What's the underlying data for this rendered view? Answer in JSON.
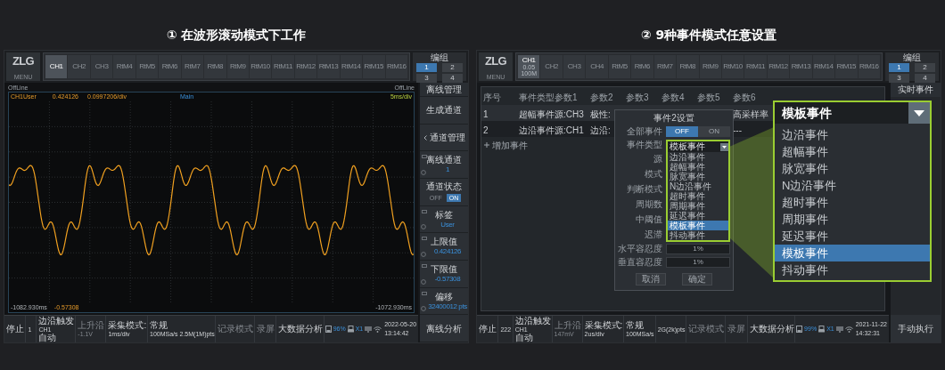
{
  "panels": [
    {
      "kind": "waveform",
      "title": "① 在波形滚动模式下工作",
      "topbar": {
        "logo": "ZLG",
        "menu": "MENU",
        "channels": [
          {
            "label": "CH1",
            "selected": true
          },
          {
            "label": "CH2",
            "selected": false
          },
          {
            "label": "CH3",
            "selected": false
          },
          {
            "label": "RtM4",
            "selected": false
          },
          {
            "label": "RtM5",
            "selected": false
          },
          {
            "label": "RtM6",
            "selected": false
          },
          {
            "label": "RtM7",
            "selected": false
          },
          {
            "label": "RtM8",
            "selected": false
          },
          {
            "label": "RtM9",
            "selected": false
          },
          {
            "label": "RtM10",
            "selected": false
          },
          {
            "label": "RtM11",
            "selected": false
          },
          {
            "label": "RtM12",
            "selected": false
          },
          {
            "label": "RtM13",
            "selected": false
          },
          {
            "label": "RtM14",
            "selected": false
          },
          {
            "label": "RtM15",
            "selected": false
          },
          {
            "label": "RtM16",
            "selected": false
          }
        ],
        "group": {
          "label": "编组",
          "buttons": [
            {
              "label": "1",
              "selected": true
            },
            {
              "label": "2",
              "selected": false
            },
            {
              "label": "3",
              "selected": false
            },
            {
              "label": "4",
              "selected": false
            }
          ]
        }
      },
      "scope": {
        "offline_left": "OffLine",
        "offline_right": "OffLine",
        "channel": "CH1User",
        "value": "0.424126",
        "scale": "0.0997206/div",
        "marker": "Main",
        "timebase": "5ms/div",
        "x_start": "-1082.930ms",
        "y_min": "-0.57308",
        "x_end": "-1072.930ms"
      },
      "sidebar": {
        "header": "离线管理",
        "items": [
          {
            "kind": "button",
            "label": "生成通道"
          },
          {
            "kind": "submenu",
            "label": "通道管理"
          },
          {
            "kind": "value",
            "label": "离线通道",
            "value": "1"
          },
          {
            "kind": "toggle",
            "label": "通道状态",
            "options": [
              {
                "label": "OFF",
                "selected": false
              },
              {
                "label": "ON",
                "selected": true
              }
            ]
          },
          {
            "kind": "value",
            "label": "标签",
            "value": "User"
          },
          {
            "kind": "value",
            "label": "上限值",
            "value": "0.424126"
          },
          {
            "kind": "value",
            "label": "下限值",
            "value": "-0.57308"
          },
          {
            "kind": "value",
            "label": "偏移",
            "value": "32400012 pts"
          },
          {
            "kind": "button",
            "label": "离线分析"
          }
        ]
      },
      "status_bar": {
        "cells": [
          {
            "lines": [
              {
                "kind": "label",
                "text": "停止"
              }
            ],
            "dim": false
          },
          {
            "lines": [
              {
                "kind": "value",
                "text": "1"
              }
            ],
            "dim": false
          },
          {
            "lines": [
              {
                "kind": "label",
                "text": "边沿触发"
              },
              {
                "kind": "value",
                "text": "CH1"
              },
              {
                "kind": "label",
                "text": "自动"
              }
            ],
            "dim": false
          },
          {
            "lines": [
              {
                "kind": "label",
                "text": "上升沿"
              },
              {
                "kind": "value",
                "text": "-1.1V"
              }
            ],
            "dim": true
          },
          {
            "lines": [
              {
                "kind": "label",
                "text": "采集模式:"
              },
              {
                "kind": "value",
                "text": "1ms/div"
              }
            ],
            "dim": false
          },
          {
            "lines": [
              {
                "kind": "label",
                "text": "常规"
              },
              {
                "kind": "value",
                "text": "100MSa/s  2.5M(1M)pts"
              }
            ],
            "dim": false
          },
          {
            "lines": [
              {
                "kind": "label",
                "text": "记录模式"
              }
            ],
            "dim": true
          },
          {
            "lines": [
              {
                "kind": "label",
                "text": "录屏"
              }
            ],
            "dim": true
          },
          {
            "lines": [
              {
                "kind": "label",
                "text": "大数据分析"
              }
            ],
            "dim": false
          }
        ],
        "storage": "96%",
        "usb": "X1",
        "date": "2022-05-20",
        "time": "13:14:42"
      }
    },
    {
      "kind": "events",
      "title": "② 9种事件模式任意设置",
      "topbar": {
        "logo": "ZLG",
        "menu": "MENU",
        "channels": [
          {
            "label": "CH1",
            "selected": true,
            "details": [
              "0.05",
              "100M"
            ]
          },
          {
            "label": "CH2",
            "selected": false
          },
          {
            "label": "CH3",
            "selected": false
          },
          {
            "label": "CH4",
            "selected": false
          },
          {
            "label": "RtM5",
            "selected": false
          },
          {
            "label": "RtM6",
            "selected": false
          },
          {
            "label": "RtM7",
            "selected": false
          },
          {
            "label": "RtM8",
            "selected": false
          },
          {
            "label": "RtM9",
            "selected": false
          },
          {
            "label": "RtM10",
            "selected": false
          },
          {
            "label": "RtM11",
            "selected": false
          },
          {
            "label": "RtM12",
            "selected": false
          },
          {
            "label": "RtM13",
            "selected": false
          },
          {
            "label": "RtM14",
            "selected": false
          },
          {
            "label": "RtM15",
            "selected": false
          },
          {
            "label": "RtM16",
            "selected": false
          }
        ],
        "group": {
          "label": "编组",
          "buttons": [
            {
              "label": "1",
              "selected": true
            },
            {
              "label": "2",
              "selected": false
            },
            {
              "label": "3",
              "selected": false
            },
            {
              "label": "4",
              "selected": false
            }
          ]
        }
      },
      "table": {
        "columns": [
          "序号",
          "事件类型",
          "参数1",
          "参数2",
          "参数3",
          "参数4",
          "参数5",
          "参数6"
        ],
        "rows": [
          {
            "index": "1",
            "type": "超幅事件",
            "param1": "源:CH3",
            "param2": "极性:",
            "param6": "高采样率"
          },
          {
            "index": "2",
            "type": "边沿事件",
            "param1": "源:CH1",
            "param2": "边沿:",
            "param6": "---"
          }
        ],
        "add_label": "增加事件"
      },
      "dialog": {
        "title": "事件2设置",
        "fields": [
          {
            "kind": "toggle",
            "label": "全部事件",
            "options": [
              {
                "label": "OFF",
                "selected": true
              },
              {
                "label": "ON",
                "selected": false
              }
            ]
          },
          {
            "kind": "select",
            "label": "事件类型",
            "value": "模板事件",
            "options": [
              {
                "label": "边沿事件",
                "selected": false
              },
              {
                "label": "超幅事件",
                "selected": false
              },
              {
                "label": "脉宽事件",
                "selected": false
              },
              {
                "label": "N边沿事件",
                "selected": false
              },
              {
                "label": "超时事件",
                "selected": false
              },
              {
                "label": "周期事件",
                "selected": false
              },
              {
                "label": "延迟事件",
                "selected": false
              },
              {
                "label": "模板事件",
                "selected": true
              },
              {
                "label": "抖动事件",
                "selected": false
              }
            ]
          },
          {
            "kind": "label",
            "label": "源"
          },
          {
            "kind": "label",
            "label": "模式"
          },
          {
            "kind": "label",
            "label": "判断模式"
          },
          {
            "kind": "label",
            "label": "周期数"
          },
          {
            "kind": "label",
            "label": "中阈值"
          },
          {
            "kind": "label",
            "label": "迟滞"
          },
          {
            "kind": "text",
            "label": "水平容忍度",
            "value": "1%"
          },
          {
            "kind": "text",
            "label": "垂直容忍度",
            "value": "1%"
          }
        ],
        "buttons": [
          "取消",
          "确定"
        ]
      },
      "callout": {
        "value": "模板事件",
        "options": [
          {
            "label": "边沿事件",
            "selected": false
          },
          {
            "label": "超幅事件",
            "selected": false
          },
          {
            "label": "脉宽事件",
            "selected": false
          },
          {
            "label": "N边沿事件",
            "selected": false
          },
          {
            "label": "超时事件",
            "selected": false
          },
          {
            "label": "周期事件",
            "selected": false
          },
          {
            "label": "延迟事件",
            "selected": false
          },
          {
            "label": "模板事件",
            "selected": true
          },
          {
            "label": "抖动事件",
            "selected": false
          }
        ]
      },
      "sidebar": {
        "top": "实时事件",
        "bottom": "手动执行"
      },
      "status_bar": {
        "cells": [
          {
            "lines": [
              {
                "kind": "label",
                "text": "停止"
              }
            ],
            "dim": false
          },
          {
            "lines": [
              {
                "kind": "value",
                "text": "222"
              }
            ],
            "dim": false
          },
          {
            "lines": [
              {
                "kind": "label",
                "text": "边沿触发"
              },
              {
                "kind": "value",
                "text": "CH1"
              },
              {
                "kind": "label",
                "text": "自动"
              }
            ],
            "dim": false
          },
          {
            "lines": [
              {
                "kind": "label",
                "text": "上升沿"
              },
              {
                "kind": "value",
                "text": "147mV"
              }
            ],
            "dim": true
          },
          {
            "lines": [
              {
                "kind": "label",
                "text": "采集模式:"
              },
              {
                "kind": "value",
                "text": "2us/div"
              }
            ],
            "dim": false
          },
          {
            "lines": [
              {
                "kind": "label",
                "text": "常规"
              },
              {
                "kind": "value",
                "text": "100MSa/s"
              }
            ],
            "dim": false
          },
          {
            "lines": [
              {
                "kind": "value",
                "text": "2G(2k)pts"
              }
            ],
            "dim": false
          },
          {
            "lines": [
              {
                "kind": "label",
                "text": "记录模式"
              }
            ],
            "dim": true
          },
          {
            "lines": [
              {
                "kind": "label",
                "text": "录屏"
              }
            ],
            "dim": true
          },
          {
            "lines": [
              {
                "kind": "label",
                "text": "大数据分析"
              }
            ],
            "dim": false
          }
        ],
        "storage": "99%",
        "usb": "X1",
        "date": "2021-11-22",
        "time": "14:32:31"
      }
    }
  ]
}
